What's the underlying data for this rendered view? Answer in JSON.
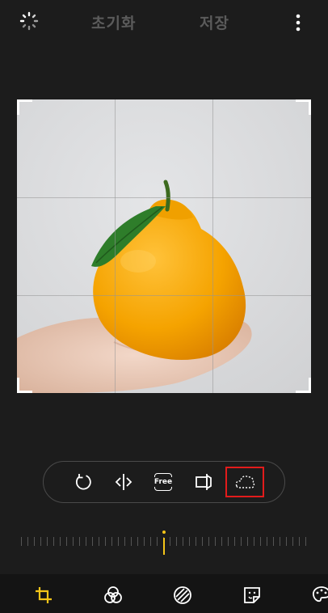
{
  "header": {
    "reset_label": "초기화",
    "save_label": "저장"
  },
  "toolbar": {
    "free_label": "Free"
  },
  "ruler": {
    "angle_value": 0
  },
  "icons": {
    "auto": "auto-crop-icon",
    "more": "more-vertical-icon",
    "rotate": "rotate-icon",
    "flip": "flip-horizontal-icon",
    "free": "free-ratio-icon",
    "perspective": "perspective-icon",
    "lasso": "lasso-icon",
    "nav": [
      "crop-icon",
      "filter-icon",
      "adjust-icon",
      "sticker-icon",
      "palette-icon"
    ]
  },
  "colors": {
    "accent": "#f5c518",
    "highlight": "#e21b1b",
    "background": "#1c1c1c"
  }
}
